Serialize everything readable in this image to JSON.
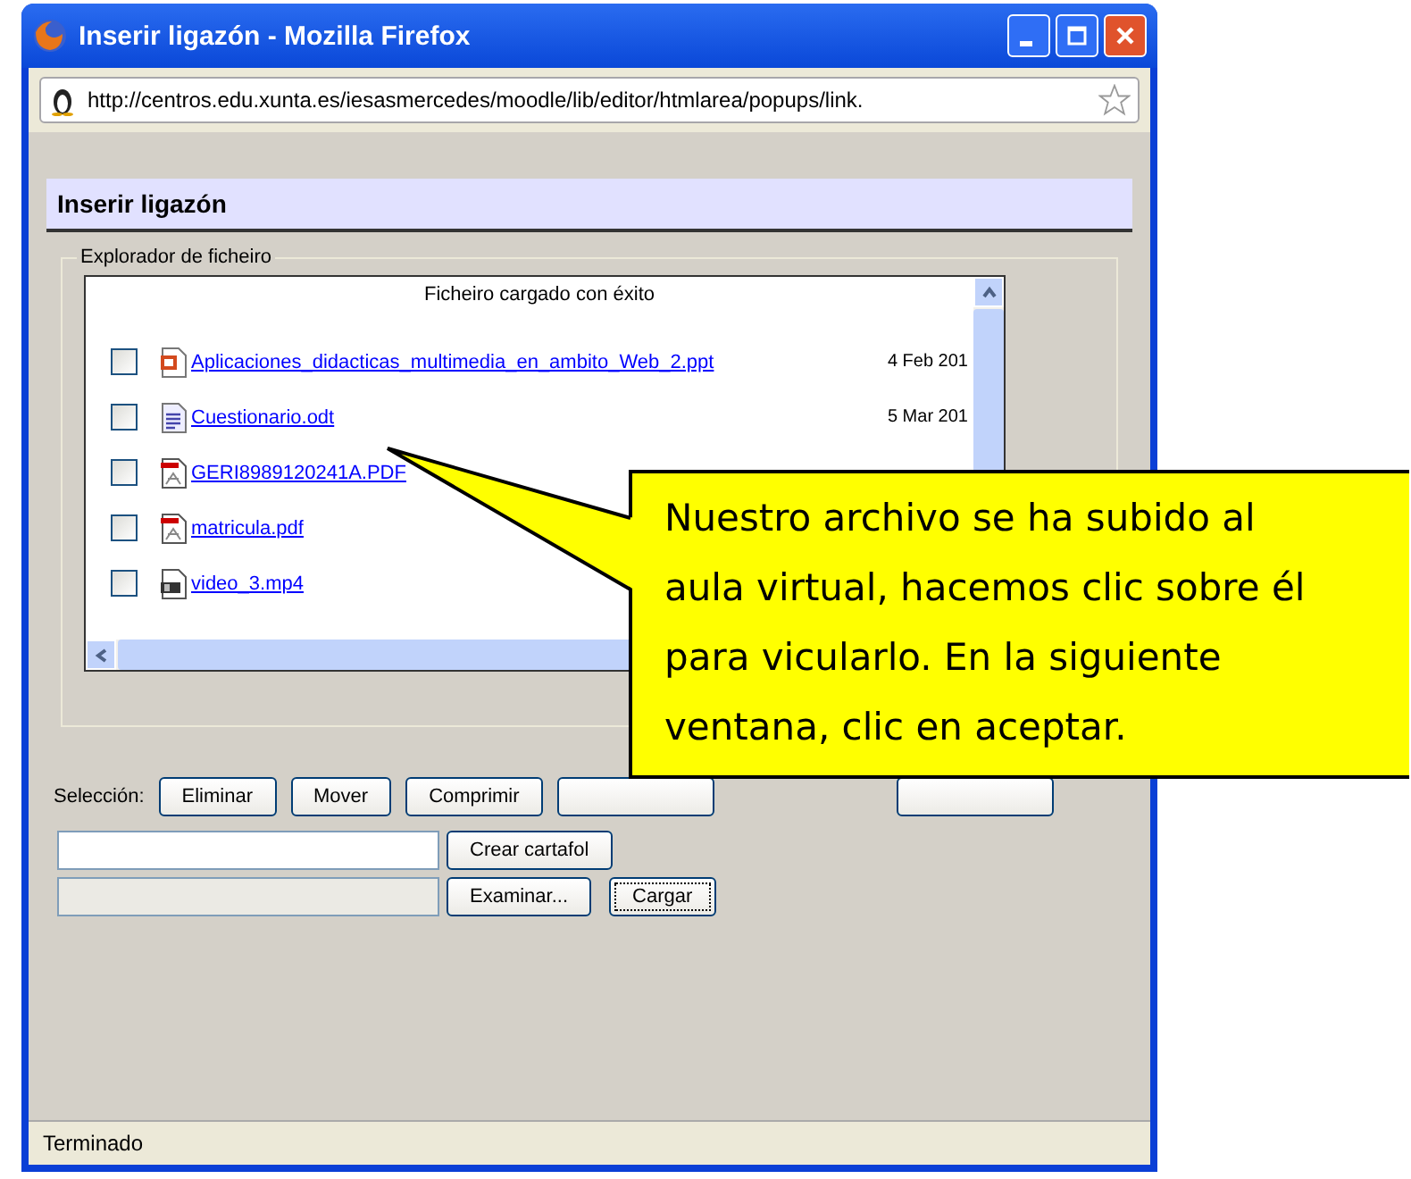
{
  "window": {
    "title": "Inserir ligazón - Mozilla Firefox"
  },
  "address_bar": {
    "url": "http://centros.edu.xunta.es/iesasmercedes/moodle/lib/editor/htmlarea/popups/link."
  },
  "dialog": {
    "title": "Inserir ligazón"
  },
  "file_explorer": {
    "legend": "Explorador de ficheiro",
    "message": "Ficheiro cargado con éxito",
    "files": [
      {
        "kind": "ppt",
        "name": "Aplicaciones_didacticas_multimedia_en_ambito_Web_2.ppt",
        "date": "4 Feb 201",
        "checked": false
      },
      {
        "kind": "doc",
        "name": "Cuestionario.odt",
        "date": "5 Mar 201",
        "checked": false
      },
      {
        "kind": "pdf",
        "name": "GERI8989120241A.PDF",
        "checked": false
      },
      {
        "kind": "pdf",
        "name": "matricula.pdf",
        "checked": false
      },
      {
        "kind": "video",
        "name": "video_3.mp4",
        "checked": false
      }
    ]
  },
  "selection": {
    "label": "Selección:",
    "buttons": [
      {
        "label": "Eliminar"
      },
      {
        "label": "Mover"
      },
      {
        "label": "Comprimir"
      },
      {
        "covered": true
      },
      {
        "covered": true
      }
    ]
  },
  "folder": {
    "button": "Crear cartafol"
  },
  "upload": {
    "browse_button": "Examinar...",
    "upload_button": "Cargar"
  },
  "status_bar": "Terminado",
  "callout": {
    "text": "Nuestro archivo se ha subido al aula virtual, hacemos clic sobre él para vicularlo. En la siguiente ventana, clic en aceptar."
  }
}
